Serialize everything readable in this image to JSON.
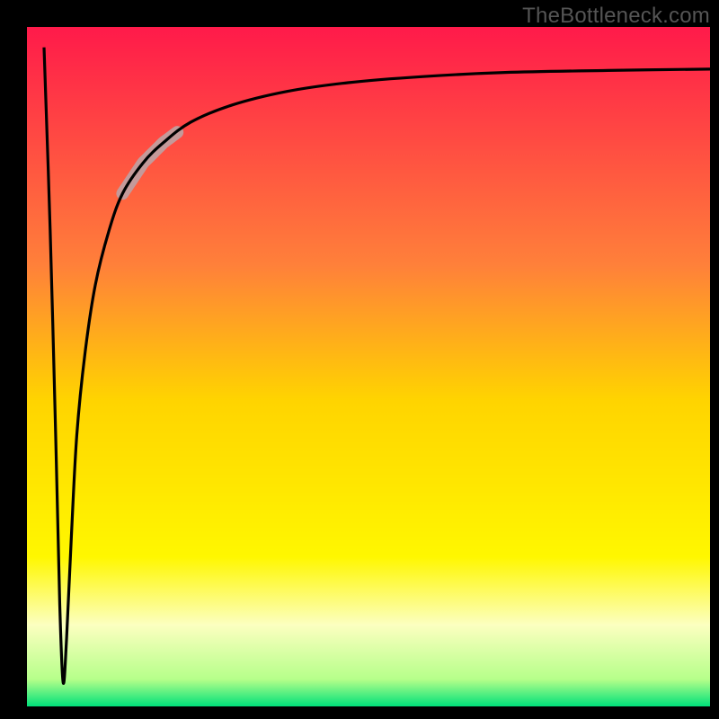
{
  "watermark": "TheBottleneck.com",
  "chart_data": {
    "type": "line",
    "title": "",
    "xlabel": "",
    "ylabel": "",
    "xlim": [
      0,
      100
    ],
    "ylim": [
      0,
      100
    ],
    "legend": false,
    "grid": false,
    "background_gradient": {
      "stops": [
        {
          "offset": 0.0,
          "color": "#ff1a4a"
        },
        {
          "offset": 0.35,
          "color": "#ff803a"
        },
        {
          "offset": 0.55,
          "color": "#ffd400"
        },
        {
          "offset": 0.78,
          "color": "#fff700"
        },
        {
          "offset": 0.88,
          "color": "#fcffc0"
        },
        {
          "offset": 0.96,
          "color": "#b6ff8a"
        },
        {
          "offset": 1.0,
          "color": "#00e07a"
        }
      ]
    },
    "series": [
      {
        "name": "bottleneck-curve",
        "x": [
          2.5,
          3.4,
          4.2,
          4.8,
          5.3,
          5.8,
          6.5,
          7.3,
          8.5,
          10,
          12,
          14,
          17,
          20,
          24,
          30,
          38,
          47,
          58,
          70,
          85,
          100
        ],
        "y": [
          97,
          70,
          40,
          15,
          3.5,
          10,
          25,
          40,
          52,
          62,
          70,
          75.5,
          80,
          83,
          86,
          88.5,
          90.5,
          91.8,
          92.7,
          93.3,
          93.6,
          93.8
        ]
      }
    ],
    "highlight_segment": {
      "series": "bottleneck-curve",
      "x_range": [
        14,
        22
      ],
      "color": "#c49a9a",
      "stroke_width": 14
    },
    "frame": {
      "inset_left": 30,
      "inset_right": 10,
      "inset_top": 30,
      "inset_bottom": 14,
      "stroke": "#000000",
      "stroke_width": 28
    }
  }
}
